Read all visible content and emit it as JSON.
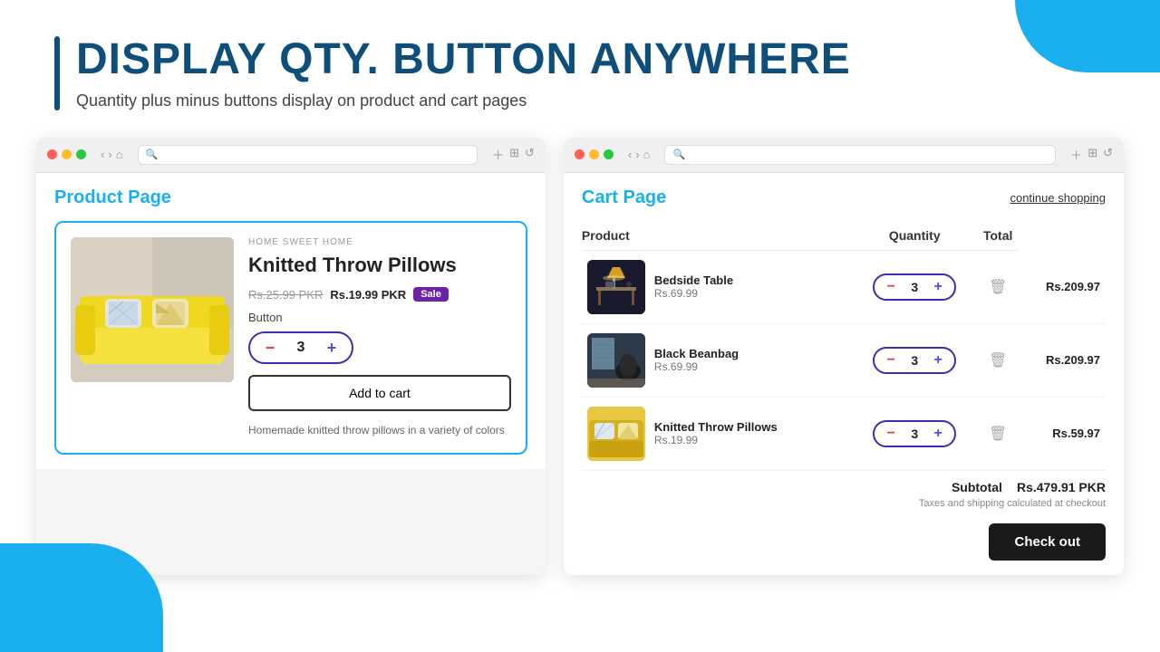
{
  "page": {
    "heading": "DISPLAY QTY. BUTTON ANYWHERE",
    "subheading": "Quantity plus minus buttons display on product and cart pages"
  },
  "decorative": {
    "blob_top_right": true,
    "blob_bottom_left": true
  },
  "product_page": {
    "title": "Product Page",
    "browser": {
      "address": ""
    },
    "product": {
      "brand": "HOME SWEET HOME",
      "name": "Knitted Throw Pillows",
      "original_price": "Rs.25.99 PKR",
      "current_price": "Rs.19.99 PKR",
      "sale_badge": "Sale",
      "button_label": "Button",
      "quantity": "3",
      "add_to_cart": "Add to cart",
      "description": "Homemade knitted throw pillows in a variety of colors"
    }
  },
  "cart_page": {
    "title": "Cart Page",
    "continue_shopping": "continue shopping",
    "columns": {
      "product": "Product",
      "quantity": "Quantity",
      "total": "Total"
    },
    "items": [
      {
        "name": "Bedside Table",
        "price": "Rs.69.99",
        "quantity": "3",
        "total": "Rs.209.97",
        "img_type": "bedside-table"
      },
      {
        "name": "Black Beanbag",
        "price": "Rs.69.99",
        "quantity": "3",
        "total": "Rs.209.97",
        "img_type": "black-beanbag"
      },
      {
        "name": "Knitted Throw Pillows",
        "price": "Rs.19.99",
        "quantity": "3",
        "total": "Rs.59.97",
        "img_type": "throw-pillow"
      }
    ],
    "subtotal_label": "Subtotal",
    "subtotal_value": "Rs.479.91 PKR",
    "subtotal_note": "Taxes and shipping calculated at checkout",
    "checkout_btn": "Check out"
  }
}
